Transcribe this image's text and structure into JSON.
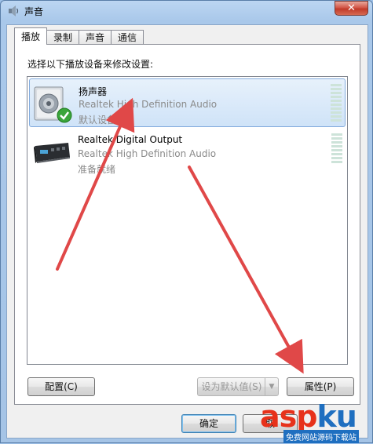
{
  "window": {
    "title": "声音",
    "close_glyph": "✕"
  },
  "tabs": [
    {
      "label": "播放",
      "active": true
    },
    {
      "label": "录制",
      "active": false
    },
    {
      "label": "声音",
      "active": false
    },
    {
      "label": "通信",
      "active": false
    }
  ],
  "instruction": "选择以下播放设备来修改设置:",
  "devices": [
    {
      "name": "扬声器",
      "driver": "Realtek High Definition Audio",
      "status": "默认设备",
      "icon": "speaker-icon",
      "selected": true,
      "default_check": true
    },
    {
      "name": "Realtek Digital Output",
      "driver": "Realtek High Definition Audio",
      "status": "准备就绪",
      "icon": "digital-output-icon",
      "selected": false,
      "default_check": false
    }
  ],
  "buttons": {
    "configure": "配置(C)",
    "set_default": "设为默认值(S)",
    "properties": "属性(P)",
    "ok": "确定",
    "cancel": "取"
  },
  "watermark": {
    "asp": "asp",
    "ku": "ku",
    "caption": "免费网站源码下载站"
  },
  "colors": {
    "annotation_arrow": "#e04848",
    "selection": "#cfe3f8"
  }
}
